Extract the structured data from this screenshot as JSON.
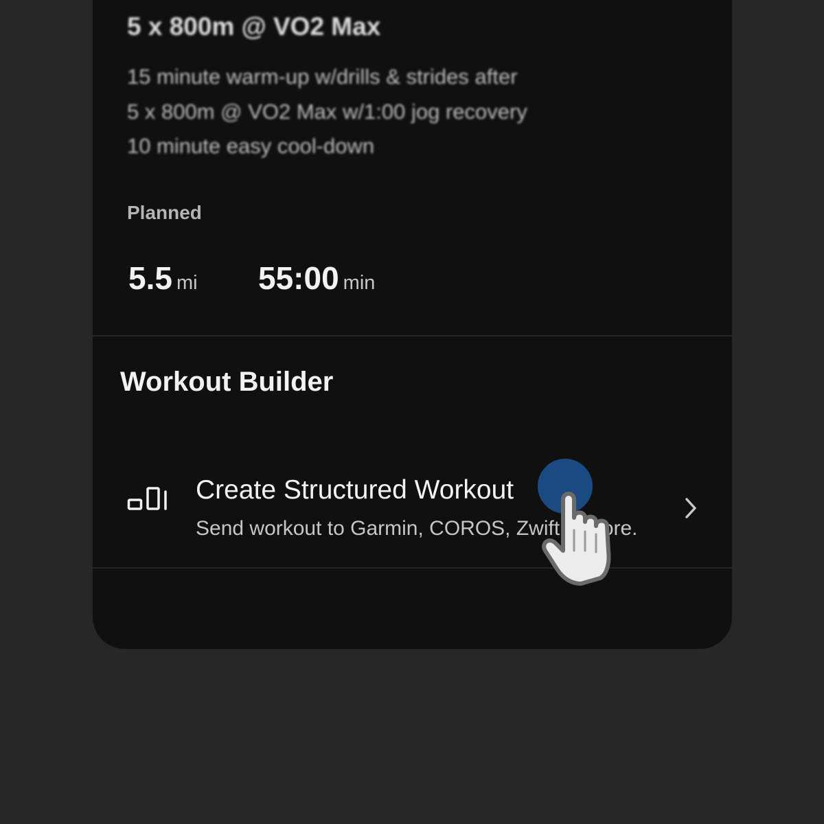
{
  "workout": {
    "title": "5 x 800m @ VO2 Max",
    "description": [
      "15 minute warm-up w/drills & strides after",
      "5 x 800m @ VO2 Max w/1:00 jog recovery",
      "10 minute easy cool-down"
    ]
  },
  "planned": {
    "label": "Planned",
    "distance_value": "5.5",
    "distance_unit": "mi",
    "duration_value": "55:00",
    "duration_unit": "min"
  },
  "workout_builder": {
    "section_title": "Workout Builder",
    "action": {
      "icon": "interval-bars-icon",
      "title": "Create Structured Workout",
      "subtitle": "Send workout to Garmin, COROS, Zwift & more.",
      "chevron_icon": "chevron-right-icon"
    }
  },
  "overlay": {
    "tap_indicator_color": "#1b4a82",
    "pointer_icon": "hand-pointer-icon"
  },
  "colors": {
    "background": "#272727",
    "card": "#101010",
    "text_primary": "#f2f2f2",
    "text_secondary": "#c6c6c6"
  }
}
